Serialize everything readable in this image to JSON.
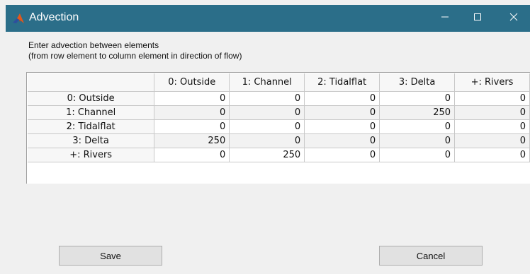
{
  "window": {
    "title": "Advection",
    "titlebar_color": "#2b6e89"
  },
  "instructions": {
    "line1": "Enter advection between elements",
    "line2": "(from row element to column element in direction of flow)"
  },
  "table": {
    "columns": [
      "0: Outside",
      "1: Channel",
      "2: Tidalflat",
      "3: Delta",
      "+: Rivers"
    ],
    "rows": [
      {
        "label": "0: Outside",
        "values": [
          "0",
          "0",
          "0",
          "0",
          "0"
        ]
      },
      {
        "label": "1: Channel",
        "values": [
          "0",
          "0",
          "0",
          "250",
          "0"
        ]
      },
      {
        "label": "2: Tidalflat",
        "values": [
          "0",
          "0",
          "0",
          "0",
          "0"
        ]
      },
      {
        "label": "3: Delta",
        "values": [
          "250",
          "0",
          "0",
          "0",
          "0"
        ]
      },
      {
        "label": "+: Rivers",
        "values": [
          "0",
          "250",
          "0",
          "0",
          "0"
        ]
      }
    ]
  },
  "buttons": {
    "save": "Save",
    "cancel": "Cancel"
  },
  "icons": {
    "app": "matlab-icon",
    "minimize": "minimize-icon",
    "maximize": "maximize-icon",
    "close": "close-icon"
  }
}
